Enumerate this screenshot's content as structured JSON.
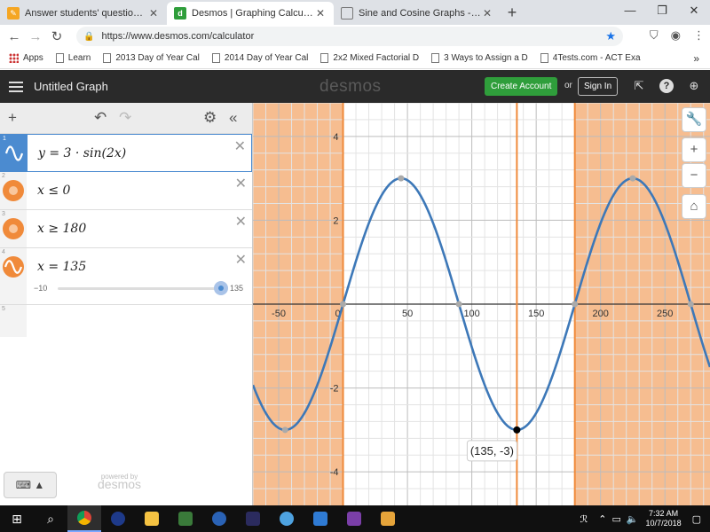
{
  "browser": {
    "tabs": [
      {
        "title": "Answer students' questions and b",
        "color": "#f5a623"
      },
      {
        "title": "Desmos | Graphing Calculator",
        "color": "#2f9e3b",
        "active": true
      },
      {
        "title": "Sine and Cosine Graphs - MathBi",
        "color": "#ffffff"
      }
    ],
    "url": "https://www.desmos.com/calculator",
    "bookmarks": [
      "Apps",
      "Learn",
      "2013 Day of Year Cal",
      "2014 Day of Year Cal",
      "2x2 Mixed Factorial D",
      "3 Ways to Assign a D",
      "4Tests.com - ACT Exa"
    ]
  },
  "header": {
    "graph_title": "Untitled Graph",
    "brand": "desmos",
    "create_account": "Create Account",
    "or": "or",
    "sign_in": "Sign In"
  },
  "expressions": [
    {
      "num": "1",
      "latex": "y = 3 · sin(2x)",
      "color": "#4b8bd0"
    },
    {
      "num": "2",
      "latex": "x ≤ 0",
      "color": "#f08a3a"
    },
    {
      "num": "3",
      "latex": "x ≥ 180",
      "color": "#f08a3a"
    },
    {
      "num": "4",
      "latex": "x = 135",
      "color": "#f08a3a",
      "slider": {
        "min": "−10",
        "max": "135",
        "value": 135
      }
    },
    {
      "num": "5"
    }
  ],
  "powered_by": {
    "line1": "powered by",
    "line2": "desmos"
  },
  "chart_data": {
    "type": "line",
    "title": "",
    "xlim": [
      -70,
      285
    ],
    "ylim": [
      -4.8,
      4.8
    ],
    "x_ticks": [
      -50,
      0,
      50,
      100,
      150,
      200,
      250
    ],
    "y_ticks": [
      -4,
      -2,
      2,
      4
    ],
    "grid": true,
    "series": [
      {
        "expr": "y = 3*sin(2x)",
        "amplitude": 3,
        "frequency": 2,
        "color": "#3d78b8"
      }
    ],
    "shaded_regions": [
      {
        "expr": "x <= 0",
        "from": -70,
        "to": 0,
        "color": "#f5b27c"
      },
      {
        "expr": "x >= 180",
        "from": 180,
        "to": 285,
        "color": "#f5b27c"
      }
    ],
    "vertical_lines": [
      {
        "x": 0,
        "color": "#f08a3a"
      },
      {
        "x": 135,
        "color": "#f08a3a"
      },
      {
        "x": 180,
        "color": "#f08a3a"
      }
    ],
    "points": [
      {
        "x": -45,
        "y": -3
      },
      {
        "x": 0,
        "y": 0
      },
      {
        "x": 45,
        "y": 3
      },
      {
        "x": 90,
        "y": 0
      },
      {
        "x": 180,
        "y": 0
      },
      {
        "x": 225,
        "y": 3
      },
      {
        "x": 270,
        "y": 0
      }
    ],
    "highlighted_point": {
      "x": 135,
      "y": -3,
      "label": "(135, -3)"
    }
  },
  "taskbar": {
    "time": "7:32 AM",
    "date": "10/7/2018"
  }
}
